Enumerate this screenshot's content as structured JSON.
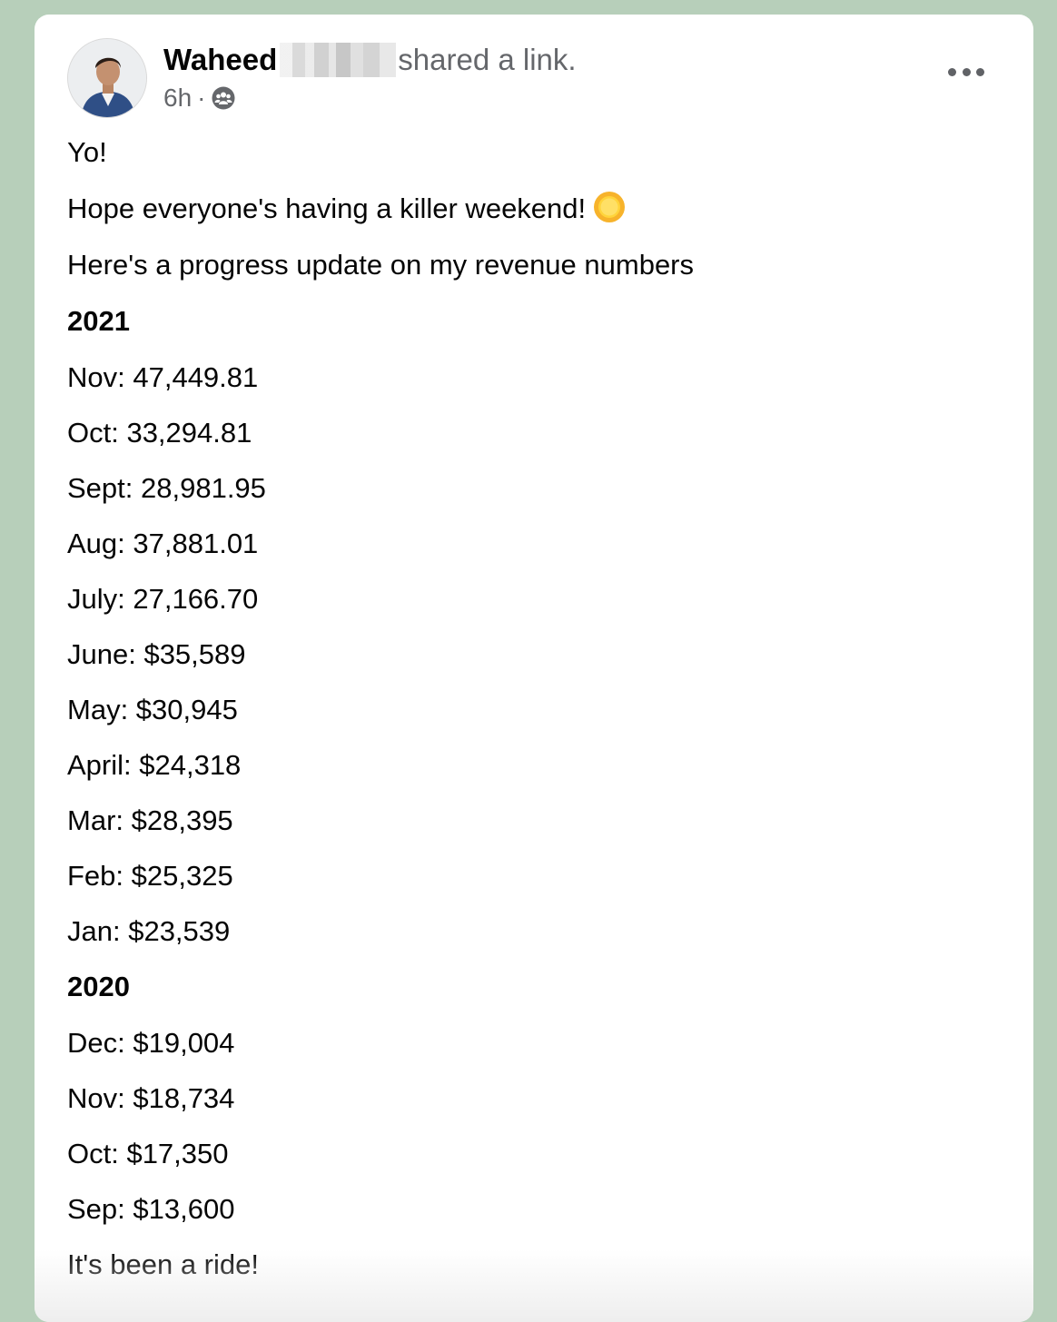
{
  "post": {
    "author": "Waheed",
    "action": "shared a link.",
    "time": "6h",
    "separator": "·",
    "audience_icon": "group-audience-icon",
    "more_icon": "more-options-icon",
    "lines": {
      "greeting": "Yo!",
      "weekend": "Hope everyone's having a killer weekend!",
      "weekend_emoji": "sun-emoji",
      "intro": "Here's a progress update on my revenue numbers",
      "year_2021": "2021",
      "nov_2021": "Nov: 47,449.81",
      "oct_2021": "Oct: 33,294.81",
      "sept_2021": "Sept: 28,981.95",
      "aug_2021": "Aug: 37,881.01",
      "july_2021": "July: 27,166.70",
      "june_2021": "June: $35,589",
      "may_2021": "May: $30,945",
      "april_2021": "April: $24,318",
      "mar_2021": "Mar: $28,395",
      "feb_2021": "Feb: $25,325",
      "jan_2021": "Jan: $23,539",
      "year_2020": "2020",
      "dec_2020": "Dec: $19,004",
      "nov_2020": "Nov: $18,734",
      "oct_2020": "Oct: $17,350",
      "sep_2020": "Sep: $13,600",
      "closing": "It's been a ride!"
    }
  },
  "colors": {
    "background": "#b7cfba",
    "card": "#ffffff",
    "primary_text": "#050505",
    "secondary_text": "#65676b"
  }
}
